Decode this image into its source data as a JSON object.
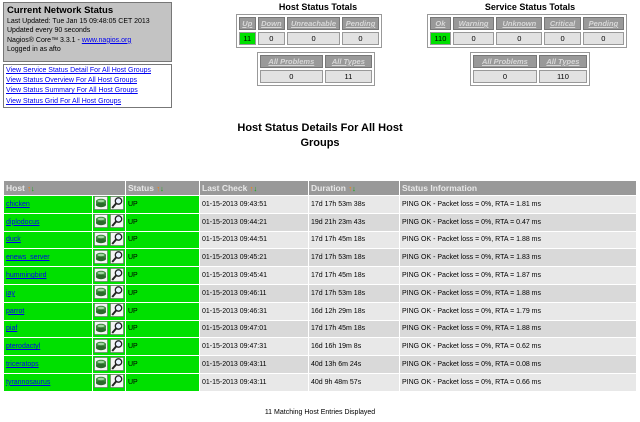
{
  "info": {
    "title": "Current Network Status",
    "last_updated": "Last Updated: Tue Jan 15 09:48:05 CET 2013",
    "interval": "Updated every 90 seconds",
    "version_prefix": "Nagios® Core™ 3.3.1 - ",
    "version_link": "www.nagios.org",
    "logged_in": "Logged in as afto"
  },
  "links": [
    "View Service Status Detail For All Host Groups",
    "View Status Overview For All Host Groups",
    "View Status Summary For All Host Groups",
    "View Status Grid For All Host Groups"
  ],
  "host_totals": {
    "title": "Host Status Totals",
    "headers": [
      "Up",
      "Down",
      "Unreachable",
      "Pending"
    ],
    "values": [
      "11",
      "0",
      "0",
      "0"
    ],
    "sum_headers": [
      "All Problems",
      "All Types"
    ],
    "sum_values": [
      "0",
      "11"
    ]
  },
  "service_totals": {
    "title": "Service Status Totals",
    "headers": [
      "Ok",
      "Warning",
      "Unknown",
      "Critical",
      "Pending"
    ],
    "values": [
      "110",
      "0",
      "0",
      "0",
      "0"
    ],
    "sum_headers": [
      "All Problems",
      "All Types"
    ],
    "sum_values": [
      "0",
      "110"
    ]
  },
  "page_title_1": "Host Status Details For All Host",
  "page_title_2": "Groups",
  "table": {
    "columns": [
      "Host",
      "Status",
      "Last Check",
      "Duration",
      "Status Information"
    ],
    "rows": [
      {
        "host": "chicken",
        "status": "UP",
        "last_check": "01-15-2013 09:43:51",
        "duration": "17d 17h 53m 38s",
        "info": "PING OK - Packet loss = 0%, RTA = 1.81 ms"
      },
      {
        "host": "diplodocus",
        "status": "UP",
        "last_check": "01-15-2013 09:44:21",
        "duration": "19d 21h 23m 43s",
        "info": "PING OK - Packet loss = 0%, RTA = 0.47 ms"
      },
      {
        "host": "duck",
        "status": "UP",
        "last_check": "01-15-2013 09:44:51",
        "duration": "17d 17h 45m 18s",
        "info": "PING OK - Packet loss = 0%, RTA = 1.88 ms"
      },
      {
        "host": "enews_server",
        "status": "UP",
        "last_check": "01-15-2013 09:45:21",
        "duration": "17d 17h 53m 18s",
        "info": "PING OK - Packet loss = 0%, RTA = 1.83 ms"
      },
      {
        "host": "hummingbird",
        "status": "UP",
        "last_check": "01-15-2013 09:45:41",
        "duration": "17d 17h 45m 18s",
        "info": "PING OK - Packet loss = 0%, RTA = 1.87 ms"
      },
      {
        "host": "jay",
        "status": "UP",
        "last_check": "01-15-2013 09:46:11",
        "duration": "17d 17h 53m 18s",
        "info": "PING OK - Packet loss = 0%, RTA = 1.88 ms"
      },
      {
        "host": "parrot",
        "status": "UP",
        "last_check": "01-15-2013 09:46:31",
        "duration": "16d 12h 29m 18s",
        "info": "PING OK - Packet loss = 0%, RTA = 1.79 ms"
      },
      {
        "host": "piaf",
        "status": "UP",
        "last_check": "01-15-2013 09:47:01",
        "duration": "17d 17h 45m 18s",
        "info": "PING OK - Packet loss = 0%, RTA = 1.88 ms"
      },
      {
        "host": "pterodactyl",
        "status": "UP",
        "last_check": "01-15-2013 09:47:31",
        "duration": "16d 16h 19m 8s",
        "info": "PING OK - Packet loss = 0%, RTA = 0.62 ms"
      },
      {
        "host": "triceratops",
        "status": "UP",
        "last_check": "01-15-2013 09:43:11",
        "duration": "40d 13h 6m 24s",
        "info": "PING OK - Packet loss = 0%, RTA = 0.08 ms"
      },
      {
        "host": "tyrannosaurus",
        "status": "UP",
        "last_check": "01-15-2013 09:43:11",
        "duration": "40d 9h 48m 57s",
        "info": "PING OK - Packet loss = 0%, RTA = 0.66 ms"
      }
    ]
  },
  "footer": "11 Matching Host Entries Displayed",
  "colors": {
    "up": "#00e000",
    "header": "#999999",
    "link": "#0000ee"
  },
  "icons": {
    "sort_up": "↑",
    "sort_down": "↓",
    "row_icon_1": "network-icon",
    "row_icon_2": "magnifier-icon"
  }
}
